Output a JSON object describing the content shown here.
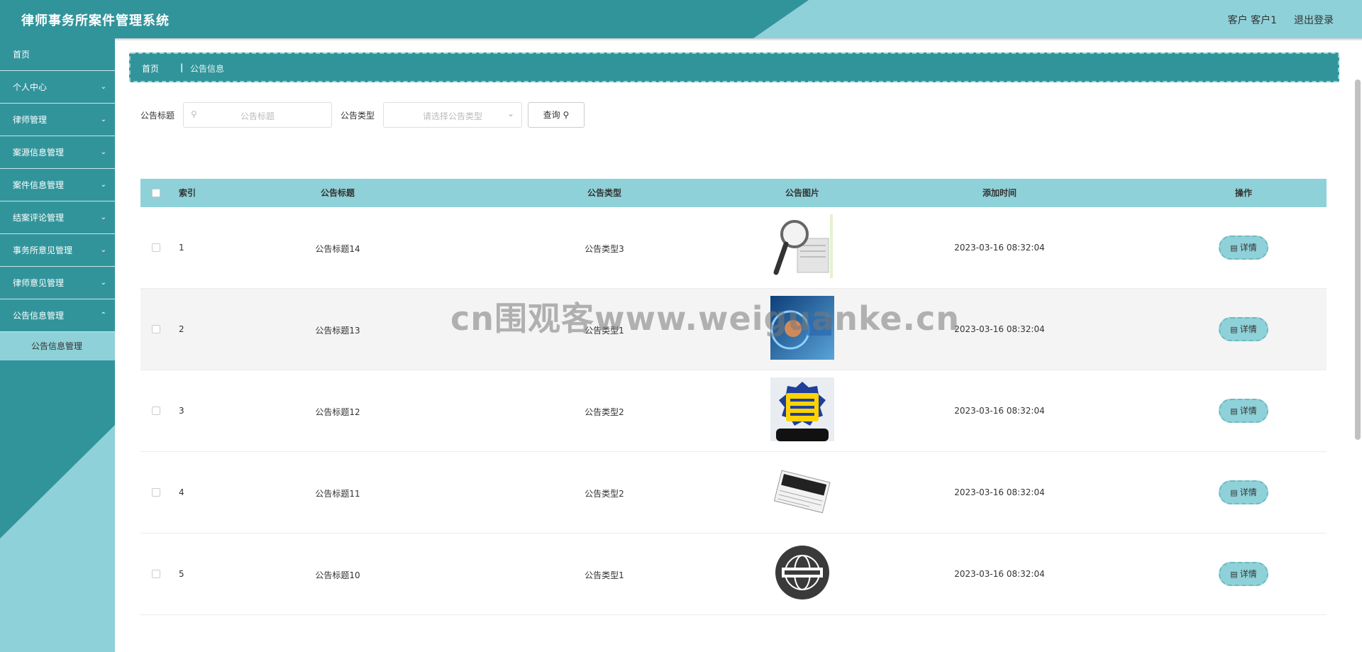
{
  "header": {
    "title": "律师事务所案件管理系统",
    "user_label": "客户 客户1",
    "logout_label": "退出登录"
  },
  "sidebar": {
    "items": [
      {
        "label": "首页",
        "has_children": false
      },
      {
        "label": "个人中心",
        "has_children": true
      },
      {
        "label": "律师管理",
        "has_children": true
      },
      {
        "label": "案源信息管理",
        "has_children": true
      },
      {
        "label": "案件信息管理",
        "has_children": true
      },
      {
        "label": "结案评论管理",
        "has_children": true
      },
      {
        "label": "事务所意见管理",
        "has_children": true
      },
      {
        "label": "律师意见管理",
        "has_children": true
      },
      {
        "label": "公告信息管理",
        "has_children": true
      }
    ],
    "active_subitem": "公告信息管理"
  },
  "breadcrumb": {
    "home": "首页",
    "separator": "|",
    "current": "公告信息"
  },
  "search": {
    "title_label": "公告标题",
    "title_placeholder": "公告标题",
    "type_label": "公告类型",
    "type_placeholder": "请选择公告类型",
    "query_button": "查询"
  },
  "table": {
    "columns": [
      "索引",
      "公告标题",
      "公告类型",
      "公告图片",
      "添加时间",
      "操作"
    ],
    "detail_label": "详情",
    "rows": [
      {
        "index": "1",
        "title": "公告标题14",
        "type": "公告类型3",
        "image": "news-magnifier-image",
        "time": "2023-03-16 08:32:04"
      },
      {
        "index": "2",
        "title": "公告标题13",
        "type": "公告类型1",
        "image": "news-blue-abstract-image",
        "time": "2023-03-16 08:32:04"
      },
      {
        "index": "3",
        "title": "公告标题12",
        "type": "公告类型2",
        "image": "hot-news-badge-image",
        "time": "2023-03-16 08:32:04"
      },
      {
        "index": "4",
        "title": "公告标题11",
        "type": "公告类型2",
        "image": "news-paper-image",
        "time": "2023-03-16 08:32:04"
      },
      {
        "index": "5",
        "title": "公告标题10",
        "type": "公告类型1",
        "image": "news-globe-image",
        "time": "2023-03-16 08:32:04"
      }
    ]
  },
  "watermark": "cn围观客www.weiguanke.cn",
  "colors": {
    "primary": "#32949b",
    "accent": "#8fd1d8"
  }
}
